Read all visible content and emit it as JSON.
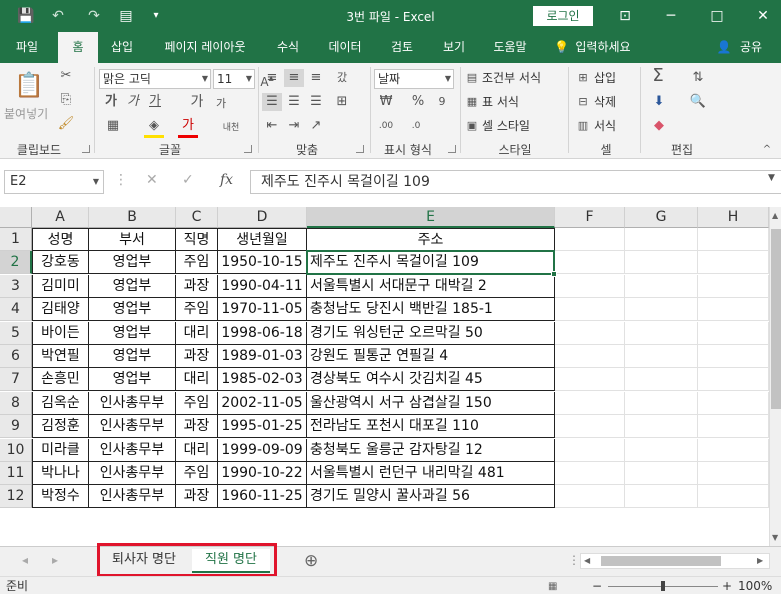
{
  "window": {
    "title": "3번 파일  -  Excel",
    "login": "로그인",
    "minimize": "─",
    "restore": "□",
    "close": "✕",
    "ribbon_toggle": "⊡"
  },
  "qat": {
    "save": "💾",
    "undo": "↶",
    "redo": "↷",
    "form": "▤",
    "more": "▾"
  },
  "menu": [
    "파일",
    "홈",
    "삽입",
    "페이지 레이아웃",
    "수식",
    "데이터",
    "검토",
    "보기",
    "도움말",
    "입력하세요",
    "공유"
  ],
  "tell_me_icon": "💡",
  "share_icon": "👤",
  "ribbon": {
    "clipboard": {
      "paste": "붙여넣기",
      "label": "클립보드"
    },
    "font": {
      "name": "맑은 고딕",
      "size": "11",
      "bold": "가",
      "italic": "가",
      "underline": "가",
      "grow": "가",
      "shrink": "가",
      "phonetic": "내천",
      "label": "글꼴"
    },
    "align": {
      "wrap": "갔",
      "label": "맞춤"
    },
    "number": {
      "format": "날짜",
      "percent": "%",
      "comma": "9",
      "label": "표시 형식"
    },
    "styles": {
      "conditional": "조건부 서식",
      "table": "표 서식",
      "cell": "셀 스타일",
      "label": "스타일"
    },
    "cells": {
      "insert": "삽입",
      "delete": "삭제",
      "format": "서식",
      "label": "셀"
    },
    "editing": {
      "sum": "Σ",
      "label": "편집"
    }
  },
  "formula_bar": {
    "name_box": "E2",
    "cancel": "✕",
    "enter": "✓",
    "fx": "fx",
    "content": "제주도 진주시 목걸이길 109"
  },
  "columns": [
    "A",
    "B",
    "C",
    "D",
    "E",
    "F",
    "G",
    "H"
  ],
  "rows": [
    "1",
    "2",
    "3",
    "4",
    "5",
    "6",
    "7",
    "8",
    "9",
    "10",
    "11",
    "12"
  ],
  "table": {
    "headers": [
      "성명",
      "부서",
      "직명",
      "생년월일",
      "주소"
    ],
    "records": [
      [
        "강호동",
        "영업부",
        "주임",
        "1950-10-15",
        "제주도 진주시 목걸이길 109"
      ],
      [
        "김미미",
        "영업부",
        "과장",
        "1990-04-11",
        "서울특별시 서대문구 대박길 2"
      ],
      [
        "김태양",
        "영업부",
        "주임",
        "1970-11-05",
        "충청남도 당진시 백반길 185-1"
      ],
      [
        "바이든",
        "영업부",
        "대리",
        "1998-06-18",
        "경기도 워싱턴군 오르막길 50"
      ],
      [
        "박연필",
        "영업부",
        "과장",
        "1989-01-03",
        "강원도 필통군 연필길 4"
      ],
      [
        "손흥민",
        "영업부",
        "대리",
        "1985-02-03",
        "경상북도 여수시 갓김치길 45"
      ],
      [
        "김옥순",
        "인사총무부",
        "주임",
        "2002-11-05",
        "울산광역시 서구 삼겹살길 150"
      ],
      [
        "김정훈",
        "인사총무부",
        "과장",
        "1995-01-25",
        "전라남도 포천시 대포길 110"
      ],
      [
        "미라클",
        "인사총무부",
        "대리",
        "1999-09-09",
        "충청북도 울릉군 감자탕길 12"
      ],
      [
        "박나나",
        "인사총무부",
        "주임",
        "1990-10-22",
        "서울특별시 런던구 내리막길 481"
      ],
      [
        "박정수",
        "인사총무부",
        "과장",
        "1960-11-25",
        "경기도 밀양시 꿀사과길 56"
      ]
    ]
  },
  "sheets": {
    "prev": "◂",
    "next": "▸",
    "tabs": [
      "퇴사자 명단",
      "직원 명단"
    ],
    "active": 1,
    "add": "⊕"
  },
  "status": {
    "ready": "준비",
    "zoom": "100%",
    "zoom_out": "−",
    "zoom_in": "+"
  }
}
